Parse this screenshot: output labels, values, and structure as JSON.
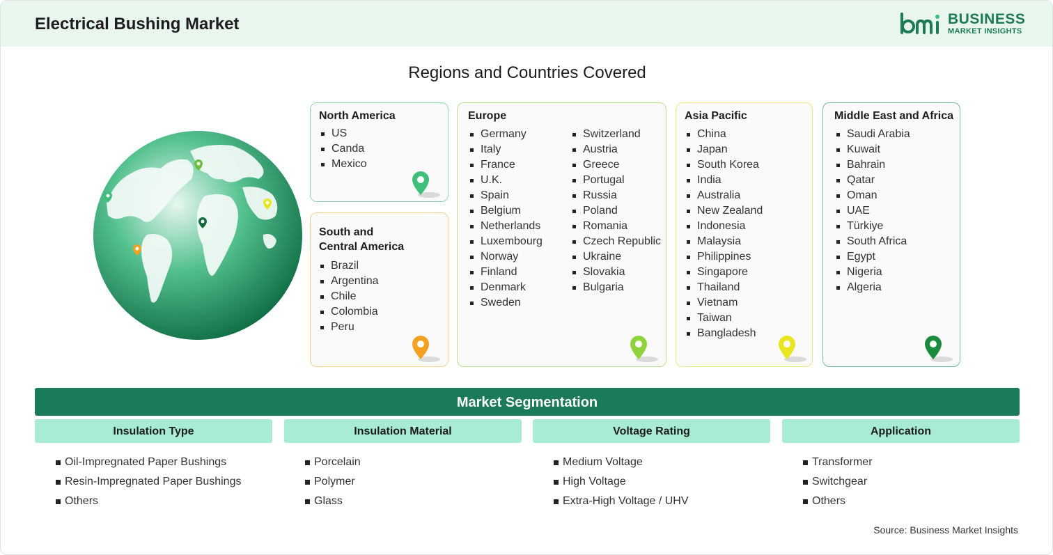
{
  "header": {
    "title": "Electrical Bushing Market",
    "logo_line1": "BUSINESS",
    "logo_line2": "MARKET INSIGHTS",
    "logo_mark": "bmi"
  },
  "regions": {
    "heading": "Regions and Countries Covered",
    "north_america": {
      "title": "North America",
      "countries": [
        "US",
        "Canda",
        "Mexico"
      ],
      "pin_color": "#3fbf7a"
    },
    "south_central_america": {
      "title_line1": "South and",
      "title_line2": "Central America",
      "countries": [
        "Brazil",
        "Argentina",
        "Chile",
        "Colombia",
        "Peru"
      ],
      "pin_color": "#f5a020"
    },
    "europe": {
      "title": "Europe",
      "col1": [
        "Germany",
        "Italy",
        "France",
        "U.K.",
        "Spain",
        "Belgium",
        "Netherlands",
        "Luxembourg",
        "Norway",
        "Finland",
        "Denmark",
        "Sweden"
      ],
      "col2": [
        "Switzerland",
        "Austria",
        "Greece",
        "Portugal",
        "Russia",
        "Poland",
        "Romania",
        "Czech Republic",
        "Ukraine",
        "Slovakia",
        "Bulgaria"
      ],
      "pin_color": "#8ed23c"
    },
    "asia_pacific": {
      "title": "Asia Pacific",
      "countries": [
        "China",
        "Japan",
        "South Korea",
        "India",
        "Australia",
        "New Zealand",
        "Indonesia",
        "Malaysia",
        "Philippines",
        "Singapore",
        "Thailand",
        "Vietnam",
        "Taiwan",
        "Bangladesh"
      ],
      "pin_color": "#e8e620"
    },
    "mea": {
      "title": "Middle East and Africa",
      "countries": [
        "Saudi Arabia",
        "Kuwait",
        "Bahrain",
        "Qatar",
        "Oman",
        "UAE",
        "Türkiye",
        "South Africa",
        "Egypt",
        "Nigeria",
        "Algeria"
      ],
      "pin_color": "#1a8a3c"
    }
  },
  "segmentation": {
    "title": "Market Segmentation",
    "columns": [
      {
        "heading": "Insulation Type",
        "items": [
          "Oil-Impregnated Paper Bushings",
          "Resin-Impregnated Paper Bushings",
          "Others"
        ]
      },
      {
        "heading": "Insulation Material",
        "items": [
          "Porcelain",
          "Polymer",
          "Glass"
        ]
      },
      {
        "heading": "Voltage Rating",
        "items": [
          "Medium Voltage",
          "High Voltage",
          "Extra-High Voltage / UHV"
        ]
      },
      {
        "heading": "Application",
        "items": [
          "Transformer",
          "Switchgear",
          "Others"
        ]
      }
    ]
  },
  "source": "Source: Business Market Insights",
  "colors": {
    "brand": "#1c7b55",
    "segment_bar": "#1a7a5a",
    "segment_head": "#a8ecd4",
    "header_bg": "#e9f6ee"
  }
}
